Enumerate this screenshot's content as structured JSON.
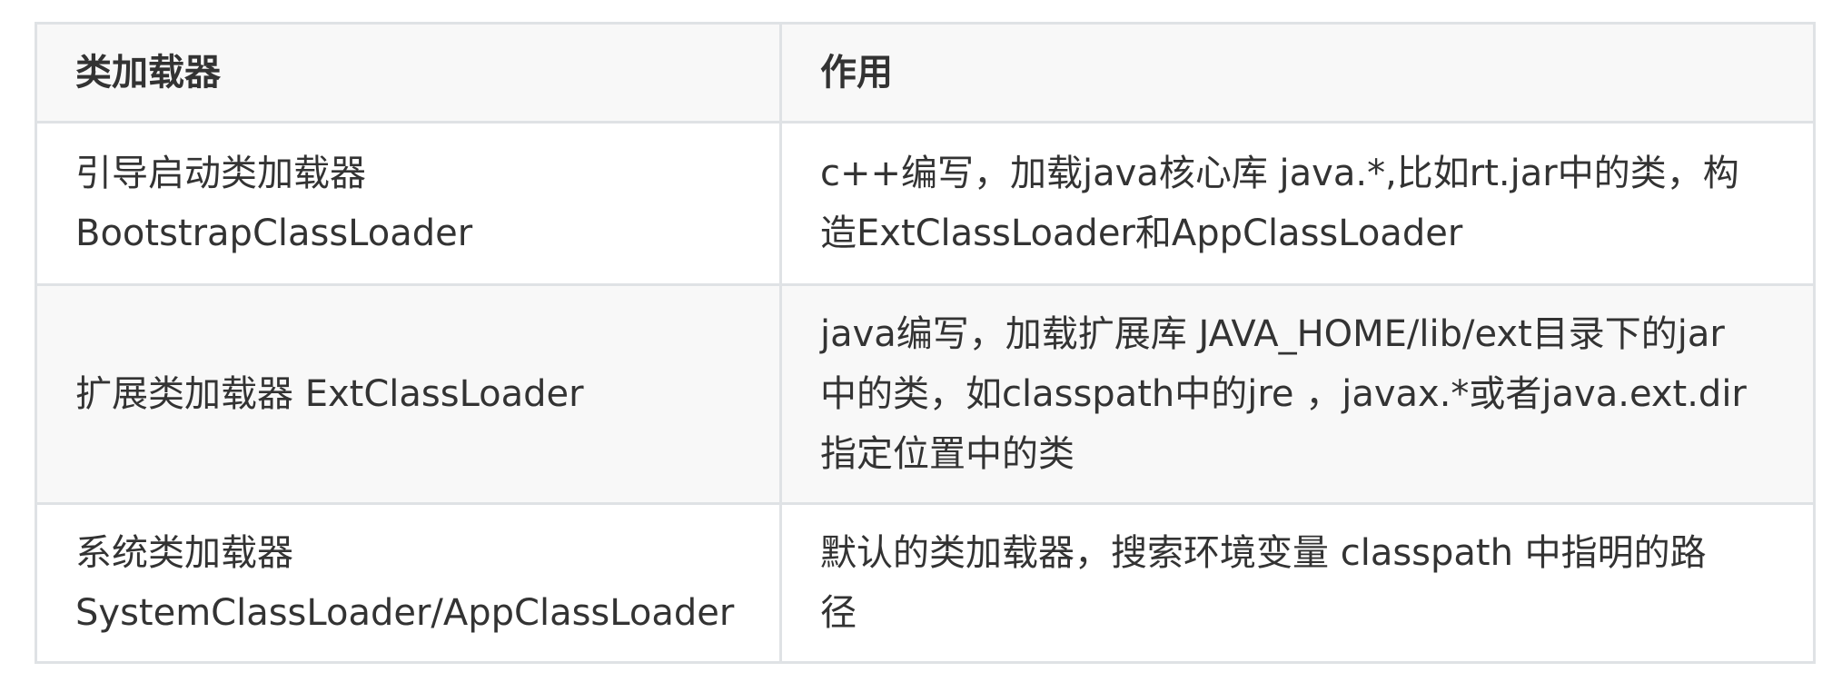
{
  "table": {
    "headers": [
      "类加载器",
      "作用"
    ],
    "rows": [
      {
        "loader": [
          "引导启动类加载器",
          "BootstrapClassLoader"
        ],
        "role": [
          "c++编写，加载java核心库 java.*,比如rt.jar中的类，构",
          "造ExtClassLoader和AppClassLoader"
        ]
      },
      {
        "loader": [
          "扩展类加载器 ExtClassLoader"
        ],
        "role": [
          "java编写，加载扩展库 JAVA_HOME/lib/ext目录下的jar",
          "中的类，如classpath中的jre ，javax.*或者java.ext.dir",
          "指定位置中的类"
        ]
      },
      {
        "loader": [
          "系统类加载器",
          "SystemClassLoader/AppClassLoader"
        ],
        "role": [
          "默认的类加载器，搜索环境变量 classpath 中指明的路",
          "径"
        ]
      }
    ]
  }
}
